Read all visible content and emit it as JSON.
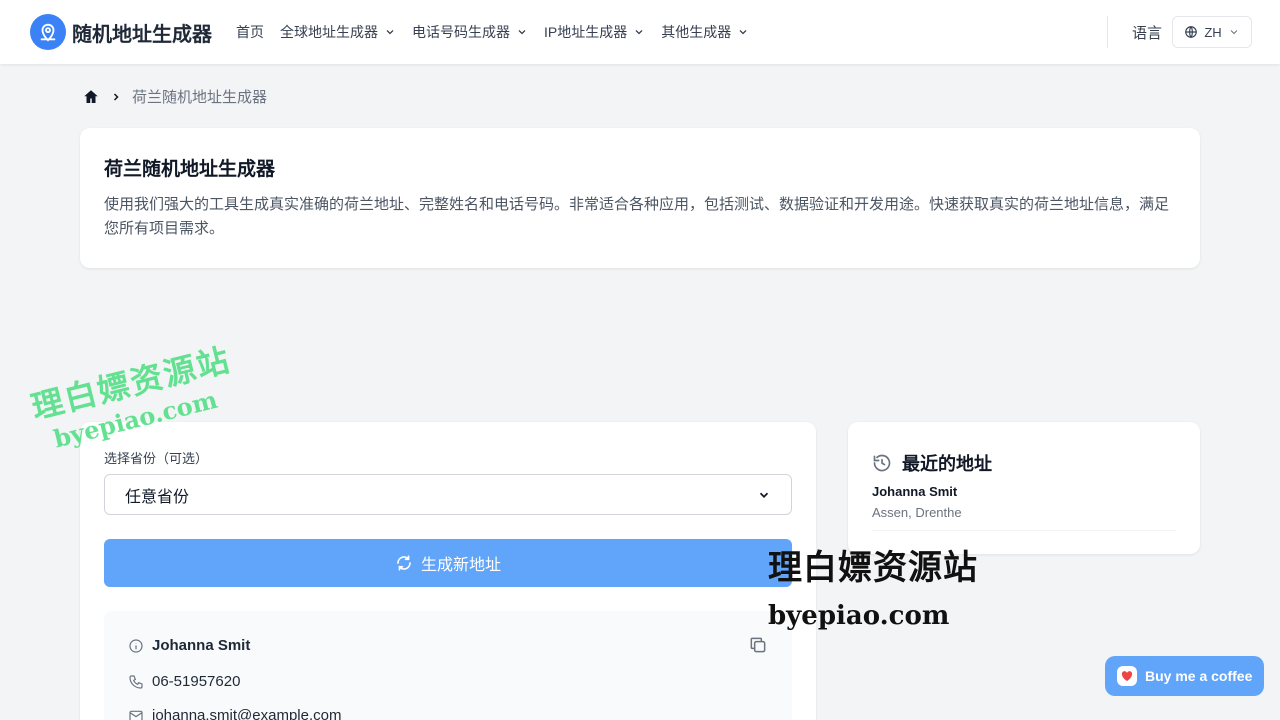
{
  "header": {
    "logo_text": "随机地址生成器",
    "nav": [
      {
        "label": "首页",
        "has_dropdown": false
      },
      {
        "label": "全球地址生成器",
        "has_dropdown": true
      },
      {
        "label": "电话号码生成器",
        "has_dropdown": true
      },
      {
        "label": "IP地址生成器",
        "has_dropdown": true
      },
      {
        "label": "其他生成器",
        "has_dropdown": true
      }
    ],
    "language_label": "语言",
    "language_value": "ZH"
  },
  "breadcrumb": {
    "current": "荷兰随机地址生成器"
  },
  "intro": {
    "title": "荷兰随机地址生成器",
    "description": "使用我们强大的工具生成真实准确的荷兰地址、完整姓名和电话号码。非常适合各种应用，包括测试、数据验证和开发用途。快速获取真实的荷兰地址信息，满足您所有项目需求。"
  },
  "generator": {
    "province_label": "选择省份（可选）",
    "province_value": "任意省份",
    "generate_button": "生成新地址",
    "result": {
      "name": "Johanna Smit",
      "phone": "06-51957620",
      "email": "johanna.smit@example.com"
    }
  },
  "recent": {
    "title": "最近的地址",
    "items": [
      {
        "name": "Johanna Smit",
        "location": "Assen, Drenthe"
      }
    ]
  },
  "watermark": {
    "cn": "理白嫖资源站",
    "en": "byepiao.com"
  },
  "coffee_button": "Buy me a coffee",
  "colors": {
    "accent": "#60a5fa",
    "logo": "#3b82f6",
    "watermark_green": "#4ade80"
  }
}
